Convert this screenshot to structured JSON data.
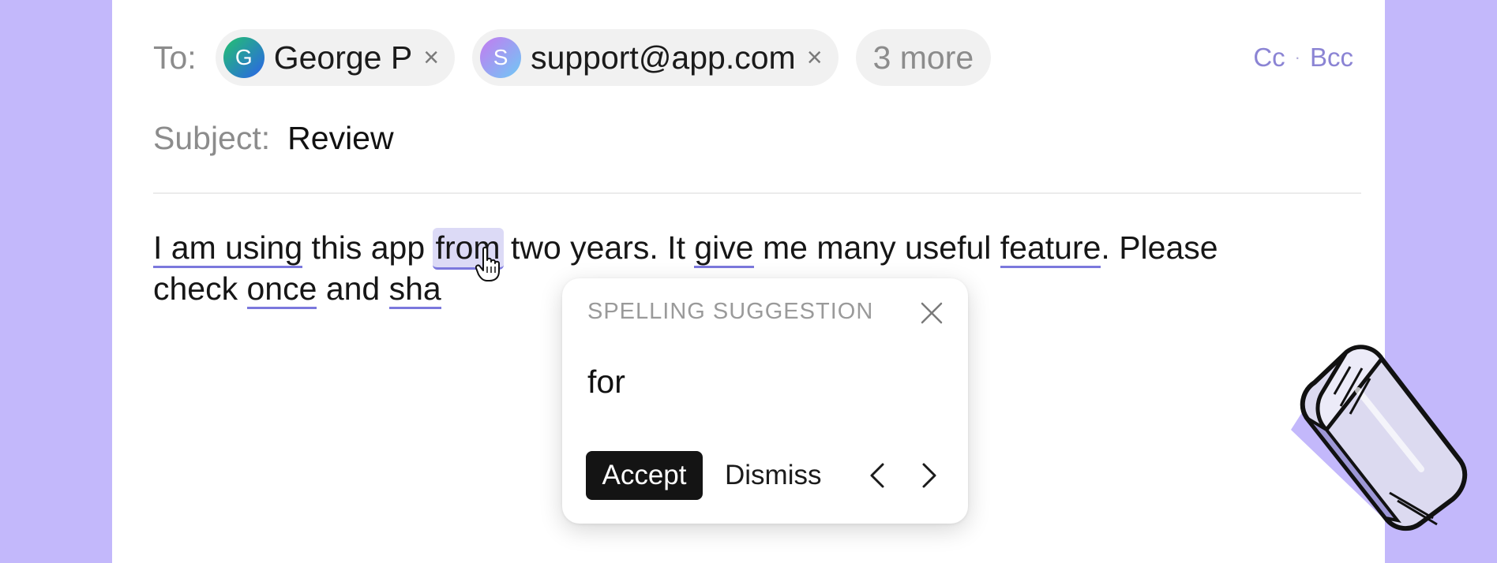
{
  "recipients": {
    "to_label": "To:",
    "chips": [
      {
        "initial": "G",
        "name": "George P",
        "remove_glyph": "×",
        "avatar_gradient": [
          "#23c26e",
          "#2b62ea"
        ]
      },
      {
        "initial": "S",
        "name": "support@app.com",
        "remove_glyph": "×",
        "avatar_gradient": [
          "#c57af0",
          "#6ec9f5"
        ]
      }
    ],
    "more_label": "3 more",
    "cc_label": "Cc",
    "separator": "·",
    "bcc_label": "Bcc"
  },
  "subject": {
    "label": "Subject:",
    "value": "Review"
  },
  "body": {
    "w1": "I am using",
    "t1": " this app ",
    "w2": "from",
    "t2": " two years. It ",
    "w3": "give",
    "t3": " me many useful ",
    "w4": "feature",
    "t4": ". Please",
    "t5": "check ",
    "w5": "once",
    "t6": " and ",
    "w6": "sha"
  },
  "popover": {
    "title": "SPELLING SUGGESTION",
    "suggestion": "for",
    "accept_label": "Accept",
    "dismiss_label": "Dismiss"
  },
  "colors": {
    "background": "#c3b8fb",
    "underline": "#7b78dd",
    "highlight": "#dcdaf6",
    "link": "#8b84d4"
  },
  "icons": [
    "close-icon",
    "chevron-left-icon",
    "chevron-right-icon",
    "hand-pointer-icon",
    "eraser-illustration"
  ]
}
